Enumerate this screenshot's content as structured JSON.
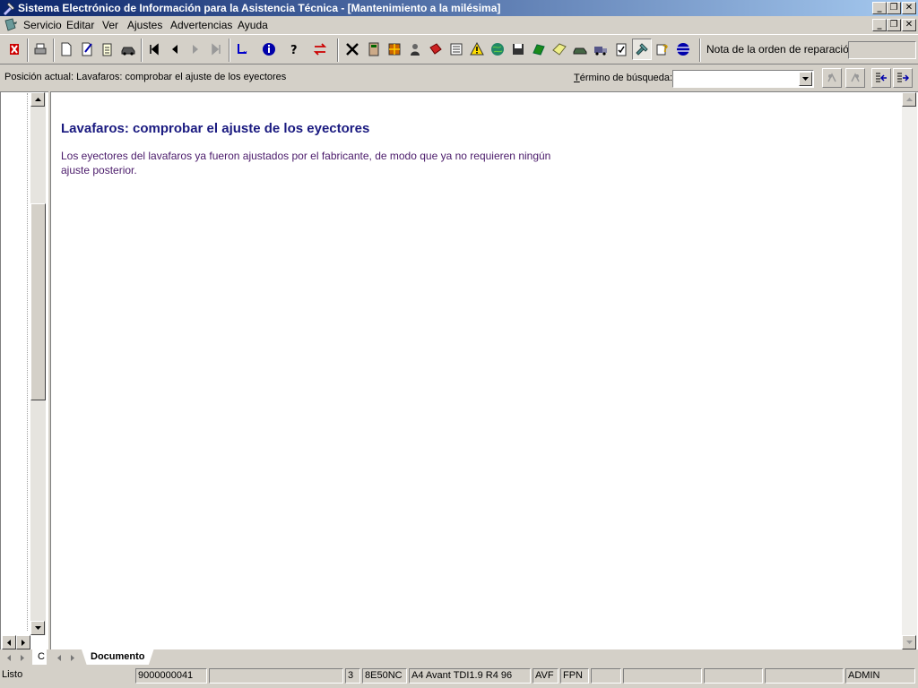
{
  "window": {
    "title": "Sistema Electrónico de Información para la Asistencia Técnica - [Mantenimiento a la milésima]",
    "minimize": "_",
    "restore": "❐",
    "close": "✕"
  },
  "menu": {
    "items": [
      "Servicio",
      "Editar",
      "Ver",
      "Ajustes",
      "Advertencias",
      "Ayuda"
    ]
  },
  "toolbar": {
    "nota_label": "Nota de la orden de reparación:",
    "nota_value": ""
  },
  "position": {
    "label": "Posición actual: Lavafaros: comprobar el ajuste de los eyectores"
  },
  "search": {
    "label": "Término de búsqueda:",
    "value": ""
  },
  "document": {
    "title": "Lavafaros: comprobar el ajuste de los eyectores",
    "body": "Los eyectores del lavafaros ya fueron ajustados por el fabricante, de modo que ya no requieren ningún ajuste posterior."
  },
  "tabs": {
    "left_tab": "C",
    "document_tab": "Documento"
  },
  "status": {
    "state": "Listo",
    "order": "9000000041",
    "field3": "",
    "num": "3",
    "code": "8E50NC",
    "vehicle": "A4 Avant TDI1.9 R4 96",
    "engine": "AVF",
    "fpn": "FPN",
    "user": "ADMIN"
  },
  "colors": {
    "title_gradient_start": "#0a246a",
    "title_gradient_end": "#a6caf0",
    "doc_title": "#1a1a80",
    "doc_body": "#4a1a6a"
  }
}
